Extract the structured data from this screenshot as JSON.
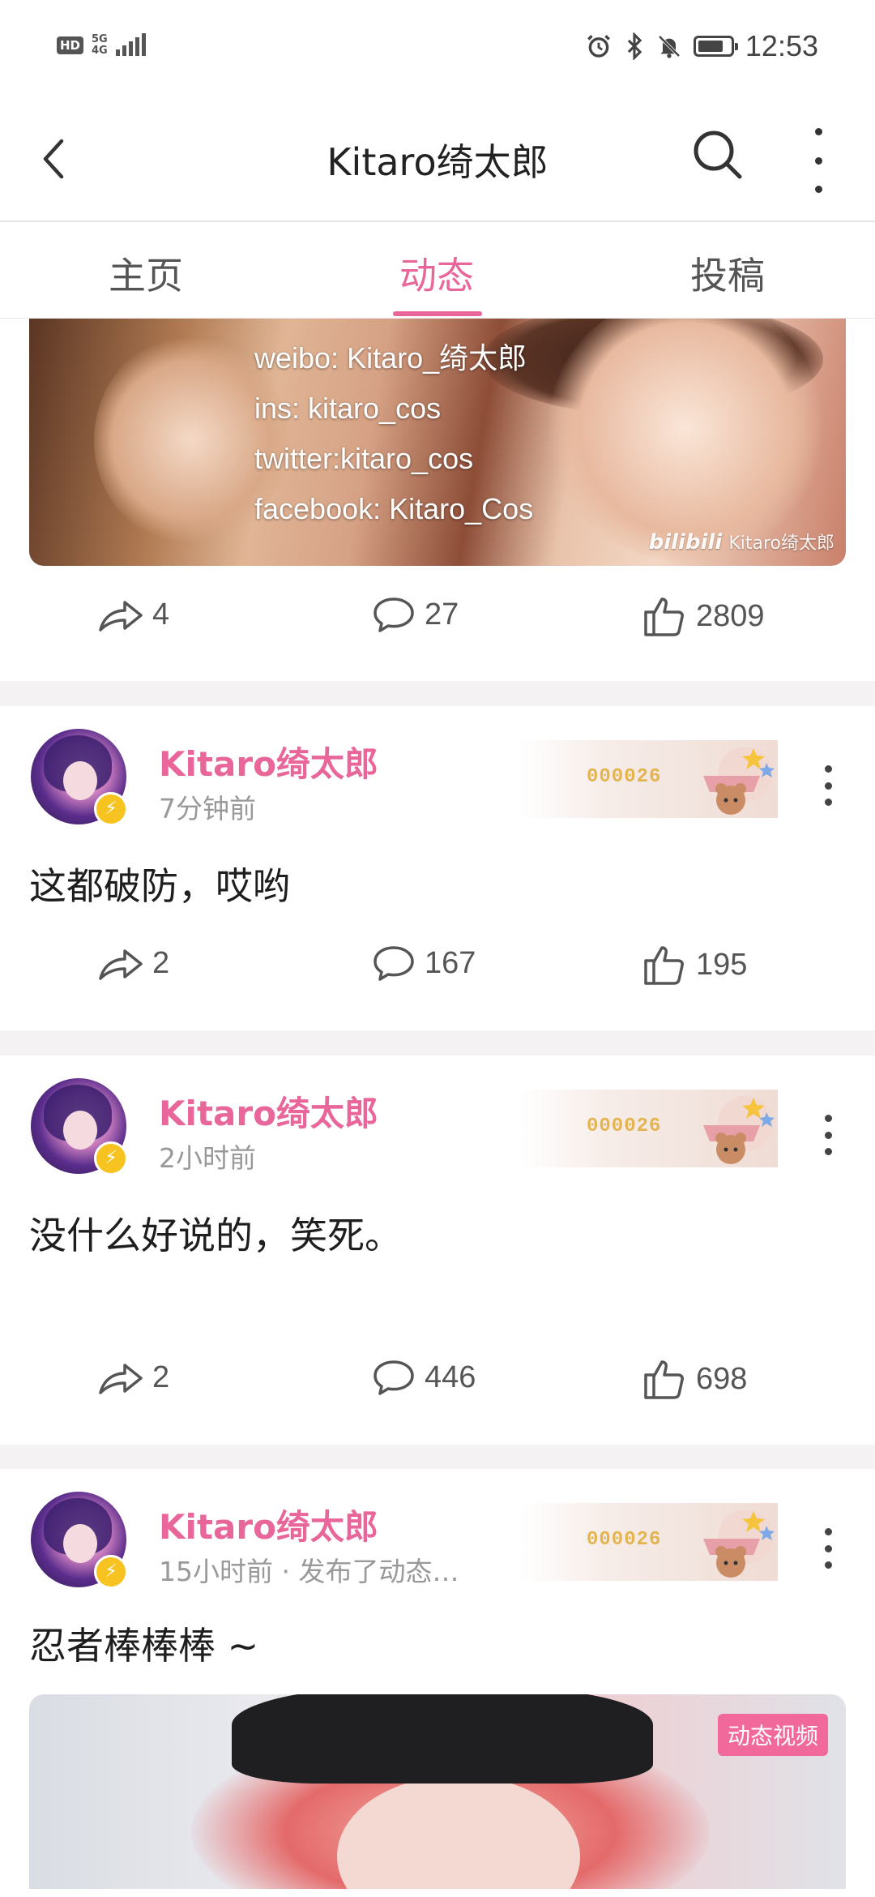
{
  "status_bar": {
    "hd": "HD",
    "network": "5G",
    "network_sub": "4G",
    "time": "12:53",
    "battery_level": 0.8
  },
  "header": {
    "title": "Kitaro绮太郎"
  },
  "tabs": [
    {
      "label": "主页",
      "active": false
    },
    {
      "label": "动态",
      "active": true
    },
    {
      "label": "投稿",
      "active": false
    }
  ],
  "top_post": {
    "banner_lines": [
      "weibo: Kitaro_绮太郎",
      "ins: kitaro_cos",
      "twitter:kitaro_cos",
      "facebook: Kitaro_Cos"
    ],
    "watermark_logo": "bilibili",
    "watermark_text": "Kitaro绮太郎",
    "share_count": "4",
    "comment_count": "27",
    "like_count": "2809"
  },
  "posts": [
    {
      "author": "Kitaro绮太郎",
      "time": "7分钟前",
      "badge_number": "000026",
      "text": "这都破防，哎哟",
      "share_count": "2",
      "comment_count": "167",
      "like_count": "195"
    },
    {
      "author": "Kitaro绮太郎",
      "time": "2小时前",
      "badge_number": "000026",
      "text": "没什么好说的，笑死。",
      "share_count": "2",
      "comment_count": "446",
      "like_count": "698"
    },
    {
      "author": "Kitaro绮太郎",
      "time": "15小时前 · 发布了动态…",
      "badge_number": "000026",
      "text": "忍者棒棒棒 ~",
      "video_badge": "动态视频"
    }
  ],
  "colors": {
    "accent": "#e9669a",
    "badge_gold": "#e3b44f",
    "verified": "#f7c320"
  }
}
